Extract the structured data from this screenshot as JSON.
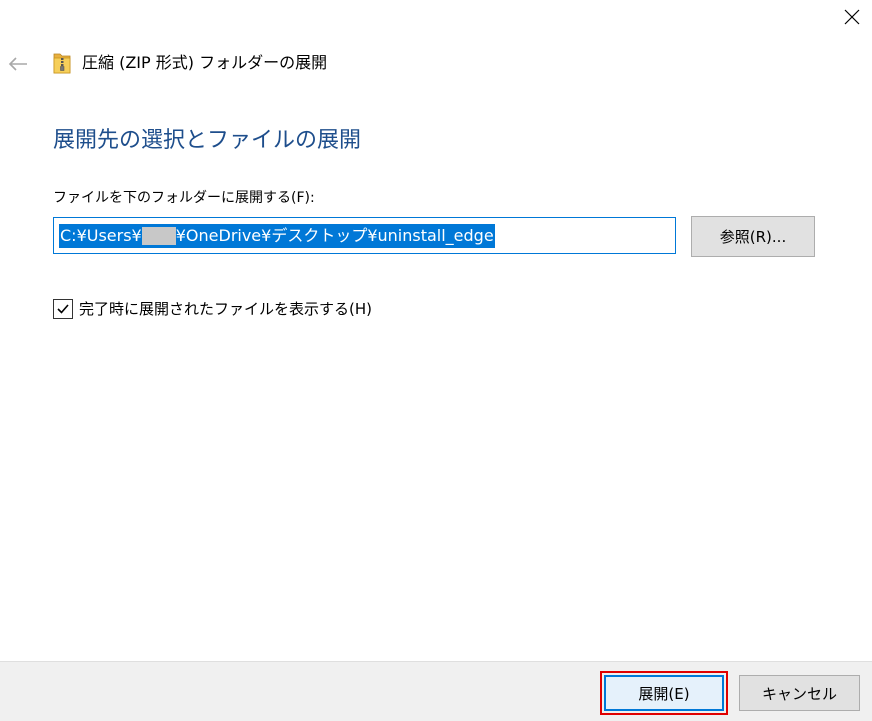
{
  "window": {
    "title": "圧縮 (ZIP 形式) フォルダーの展開",
    "close_icon": "close-icon",
    "back_icon": "back-arrow-icon",
    "folder_icon": "zip-folder-icon"
  },
  "main": {
    "heading": "展開先の選択とファイルの展開",
    "field_label": "ファイルを下のフォルダーに展開する(F):",
    "path": {
      "prefix": "C:¥Users¥",
      "suffix": "¥OneDrive¥デスクトップ¥uninstall_edge"
    },
    "browse_label": "参照(R)...",
    "checkbox": {
      "label": "完了時に展開されたファイルを表示する(H)",
      "checked": true
    }
  },
  "footer": {
    "extract_label": "展開(E)",
    "cancel_label": "キャンセル"
  },
  "colors": {
    "heading": "#1e4e8c",
    "accent": "#0078d7",
    "highlight": "#e00000",
    "footer_bg": "#f0f0f0"
  }
}
